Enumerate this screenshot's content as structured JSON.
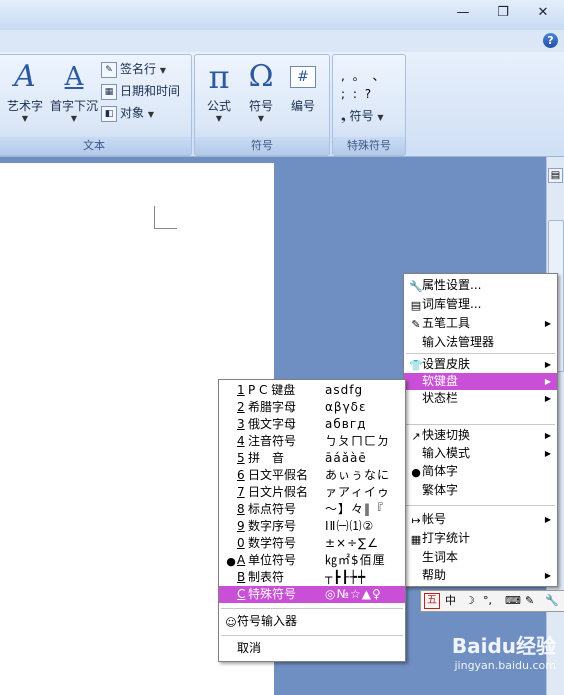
{
  "window": {
    "minimize": "—",
    "restore": "❐",
    "close": "✕",
    "help": "?"
  },
  "ribbon": {
    "text_group": {
      "label": "文本",
      "wordart": "艺术字",
      "dropcap": "首字下沉",
      "signature": "签名行",
      "datetime": "日期和时间",
      "object": "对象"
    },
    "symbol_group": {
      "label": "符号",
      "equation": "公式",
      "symbol": "符号",
      "number": "编号"
    },
    "special_group": {
      "label": "特殊符号",
      "row1": ",  。 、",
      "row2": ";  :  ?",
      "symbol": "符号"
    }
  },
  "ime_menu": {
    "items": [
      {
        "icon": "wrench-icon",
        "label": "属性设置...",
        "arrow": false
      },
      {
        "icon": "dictionary-icon",
        "label": "词库管理...",
        "arrow": false
      },
      {
        "icon": "pen-icon",
        "label": "五笔工具",
        "arrow": true
      },
      {
        "icon": "",
        "label": "输入法管理器",
        "arrow": false
      },
      {
        "icon": "shirt-icon",
        "label": "设置皮肤",
        "arrow": true
      },
      {
        "icon": "",
        "label": "软键盘",
        "arrow": true
      },
      {
        "icon": "",
        "label": "状态栏",
        "arrow": true
      },
      {
        "icon": "arrow-icon",
        "label": "快速切换",
        "arrow": true
      },
      {
        "icon": "",
        "label": "输入模式",
        "arrow": true
      },
      {
        "icon": "bullet-icon",
        "label": "简体字",
        "arrow": false
      },
      {
        "icon": "",
        "label": "繁体字",
        "arrow": false
      },
      {
        "icon": "account-icon",
        "label": "帐号",
        "arrow": true
      },
      {
        "icon": "stats-icon",
        "label": "打字统计",
        "arrow": false
      },
      {
        "icon": "",
        "label": "生词本",
        "arrow": false
      },
      {
        "icon": "",
        "label": "帮助",
        "arrow": true
      }
    ]
  },
  "keyboard_menu": {
    "items": [
      {
        "key": "1",
        "label": "P C 键盘",
        "sample": "asdfg"
      },
      {
        "key": "2",
        "label": "希腊字母",
        "sample": "αβγδε"
      },
      {
        "key": "3",
        "label": "俄文字母",
        "sample": "абвгд"
      },
      {
        "key": "4",
        "label": "注音符号",
        "sample": "ㄅㄆㄇㄈㄉ"
      },
      {
        "key": "5",
        "label": "拼　音",
        "sample": "āáǎàē"
      },
      {
        "key": "6",
        "label": "日文平假名",
        "sample": "あぃぅなに"
      },
      {
        "key": "7",
        "label": "日文片假名",
        "sample": "ァアィイゥ"
      },
      {
        "key": "8",
        "label": "标点符号",
        "sample": "～】々‖『"
      },
      {
        "key": "9",
        "label": "数字序号",
        "sample": "ⅠⅡ㈠⑴②"
      },
      {
        "key": "0",
        "label": "数学符号",
        "sample": "±×÷∑∠"
      },
      {
        "key": "A",
        "label": "单位符号",
        "sample": "㎏㎡$佰厘"
      },
      {
        "key": "B",
        "label": "制表符",
        "sample": "┬┣┠┾┿"
      },
      {
        "key": "C",
        "label": "特殊符号",
        "sample": "◎№☆▲♀"
      }
    ],
    "tool": "符号输入器",
    "cancel": "取消"
  },
  "ime_status": {
    "logo": "五",
    "mode": "中",
    "moon": "☽",
    "punct": "°,",
    "keyboard": "⌨",
    "tool": "✎"
  },
  "watermark": {
    "brand": "Baidu经验",
    "url": "jingyan.baidu.com"
  }
}
